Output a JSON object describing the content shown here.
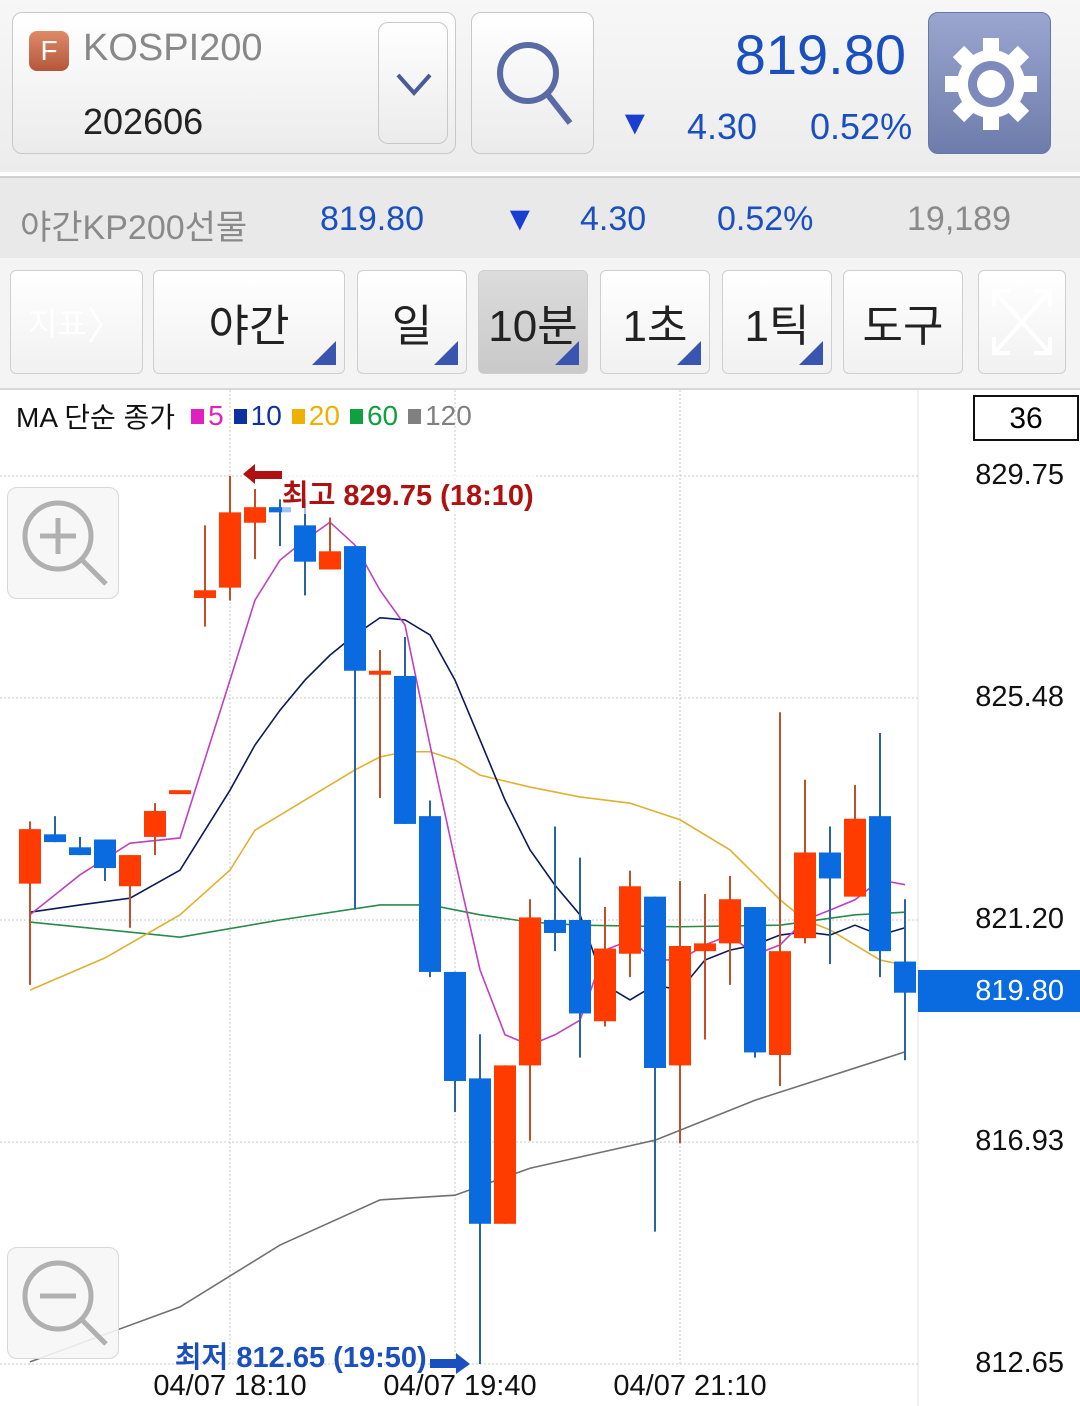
{
  "header": {
    "badge": "F",
    "symbol": "KOSPI200",
    "contract": "202606",
    "price": "819.80",
    "change_arrow": "▼",
    "change": "4.30",
    "change_pct": "0.52%"
  },
  "subbar": {
    "name": "야간KP200선물",
    "price": "819.80",
    "arrow": "▼",
    "change": "4.30",
    "change_pct": "0.52%",
    "volume": "19,189"
  },
  "toolbar": {
    "indicator": "지표",
    "buttons": [
      {
        "label": "야간",
        "selected": false
      },
      {
        "label": "일",
        "selected": false
      },
      {
        "label": "10분",
        "selected": true
      },
      {
        "label": "1초",
        "selected": false
      },
      {
        "label": "1틱",
        "selected": false
      }
    ],
    "tools": "도구"
  },
  "colors": {
    "up": "#ff3b00",
    "down": "#0a6adf",
    "accent": "#1a4fc0",
    "high": "#b01010"
  },
  "chart_data": {
    "type": "candlestick",
    "legend": {
      "title": "MA 단순 종가",
      "items": [
        {
          "label": "5",
          "color": "#e020c0"
        },
        {
          "label": "10",
          "color": "#1030a0"
        },
        {
          "label": "20",
          "color": "#f0b000"
        },
        {
          "label": "60",
          "color": "#10a040"
        },
        {
          "label": "120",
          "color": "#808080"
        }
      ]
    },
    "visible_count": "36",
    "ylim": [
      812.65,
      829.75
    ],
    "yticks": [
      "829.75",
      "825.48",
      "821.20",
      "816.93",
      "812.65"
    ],
    "xticks": [
      {
        "index": 8,
        "label": "04/07 18:10"
      },
      {
        "index": 17,
        "label": "04/07 19:40"
      },
      {
        "index": 26,
        "label": "04/07 21:10"
      }
    ],
    "current_price": "819.80",
    "high_label": "최고 829.75 (18:10)",
    "high_index": 9,
    "low_label": "최저 812.65 (19:50)",
    "low_index": 18,
    "candles": [
      [
        821.9,
        823.1,
        819.95,
        822.95
      ],
      [
        822.85,
        823.2,
        822.7,
        822.7
      ],
      [
        822.6,
        822.8,
        822.45,
        822.45
      ],
      [
        822.75,
        822.75,
        821.95,
        822.2
      ],
      [
        821.85,
        822.45,
        821.05,
        822.45
      ],
      [
        822.8,
        823.45,
        822.45,
        823.3
      ],
      [
        823.7,
        823.7,
        823.7,
        823.7
      ],
      [
        827.4,
        828.8,
        826.85,
        827.55
      ],
      [
        827.6,
        829.75,
        827.35,
        829.05
      ],
      [
        828.85,
        829.5,
        828.15,
        829.15
      ],
      [
        829.15,
        829.3,
        828.4,
        829.05
      ],
      [
        828.8,
        829.3,
        827.45,
        828.1
      ],
      [
        827.95,
        828.95,
        827.95,
        828.3
      ],
      [
        828.4,
        828.4,
        821.4,
        826.0
      ],
      [
        825.95,
        826.4,
        823.55,
        826.0
      ],
      [
        825.9,
        826.65,
        823.05,
        823.05
      ],
      [
        823.2,
        823.5,
        820.1,
        820.2
      ],
      [
        820.2,
        820.2,
        817.5,
        818.1
      ],
      [
        818.15,
        819.0,
        812.65,
        815.35
      ],
      [
        815.35,
        818.4,
        815.35,
        818.4
      ],
      [
        818.4,
        821.6,
        816.95,
        821.25
      ],
      [
        821.2,
        823.0,
        820.6,
        820.95
      ],
      [
        821.2,
        822.4,
        818.55,
        819.4
      ],
      [
        819.25,
        821.45,
        819.15,
        820.65
      ],
      [
        820.55,
        822.15,
        820.1,
        821.85
      ],
      [
        821.65,
        821.65,
        815.2,
        818.35
      ],
      [
        818.4,
        821.95,
        816.9,
        820.7
      ],
      [
        820.6,
        821.7,
        818.9,
        820.75
      ],
      [
        820.75,
        822.05,
        819.95,
        821.6
      ],
      [
        821.45,
        821.45,
        818.55,
        818.65
      ],
      [
        818.6,
        825.2,
        818.0,
        820.6
      ],
      [
        820.85,
        823.9,
        820.75,
        822.5
      ],
      [
        822.5,
        823.0,
        820.35,
        822.0
      ],
      [
        821.65,
        823.8,
        821.65,
        823.15
      ],
      [
        823.2,
        824.8,
        820.1,
        820.6
      ],
      [
        820.4,
        821.6,
        818.5,
        819.8
      ]
    ],
    "ma": {
      "5": [
        [
          0,
          821.3
        ],
        [
          2,
          822.07
        ],
        [
          4,
          822.68
        ],
        [
          6,
          822.78
        ],
        [
          8,
          825.82
        ],
        [
          9,
          827.36
        ],
        [
          10,
          828.13
        ],
        [
          11,
          828.52
        ],
        [
          12,
          828.86
        ],
        [
          13,
          828.42
        ],
        [
          14,
          827.55
        ],
        [
          15,
          826.88
        ],
        [
          16,
          824.57
        ],
        [
          17,
          822.36
        ],
        [
          18,
          820.24
        ],
        [
          19,
          818.99
        ],
        [
          20,
          818.79
        ],
        [
          21,
          818.99
        ],
        [
          22,
          819.27
        ],
        [
          23,
          820.62
        ],
        [
          24,
          820.81
        ],
        [
          25,
          820.43
        ],
        [
          26,
          820.43
        ],
        [
          27,
          820.72
        ],
        [
          28,
          820.91
        ],
        [
          29,
          820.53
        ],
        [
          30,
          820.72
        ],
        [
          31,
          821.2
        ],
        [
          32,
          821.39
        ],
        [
          33,
          821.59
        ],
        [
          34,
          821.97
        ],
        [
          35,
          821.88
        ]
      ],
      "10": [
        [
          0,
          821.35
        ],
        [
          2,
          821.49
        ],
        [
          4,
          821.62
        ],
        [
          6,
          822.16
        ],
        [
          8,
          823.7
        ],
        [
          9,
          824.57
        ],
        [
          10,
          825.24
        ],
        [
          11,
          825.82
        ],
        [
          12,
          826.3
        ],
        [
          13,
          826.69
        ],
        [
          14,
          827.02
        ],
        [
          15,
          826.98
        ],
        [
          16,
          826.69
        ],
        [
          17,
          825.82
        ],
        [
          18,
          824.67
        ],
        [
          19,
          823.51
        ],
        [
          20,
          822.55
        ],
        [
          21,
          821.87
        ],
        [
          22,
          821.3
        ],
        [
          23,
          819.95
        ],
        [
          24,
          819.66
        ],
        [
          25,
          819.95
        ],
        [
          26,
          819.85
        ],
        [
          27,
          820.43
        ],
        [
          28,
          820.62
        ],
        [
          29,
          820.72
        ],
        [
          30,
          820.91
        ],
        [
          31,
          820.97
        ],
        [
          32,
          820.91
        ],
        [
          33,
          821.1
        ],
        [
          34,
          820.91
        ],
        [
          35,
          821.05
        ]
      ],
      "20": [
        [
          0,
          819.85
        ],
        [
          3,
          820.47
        ],
        [
          6,
          821.3
        ],
        [
          8,
          822.16
        ],
        [
          9,
          822.93
        ],
        [
          11,
          823.51
        ],
        [
          13,
          824.09
        ],
        [
          14,
          824.34
        ],
        [
          15,
          824.44
        ],
        [
          16,
          824.44
        ],
        [
          17,
          824.28
        ],
        [
          18,
          823.99
        ],
        [
          20,
          823.76
        ],
        [
          22,
          823.57
        ],
        [
          24,
          823.45
        ],
        [
          26,
          823.13
        ],
        [
          28,
          822.55
        ],
        [
          29,
          822.07
        ],
        [
          30,
          821.59
        ],
        [
          31,
          821.2
        ],
        [
          32,
          821.01
        ],
        [
          33,
          820.72
        ],
        [
          34,
          820.43
        ],
        [
          35,
          820.33
        ]
      ],
      "60": [
        [
          0,
          821.16
        ],
        [
          6,
          820.87
        ],
        [
          10,
          821.2
        ],
        [
          14,
          821.49
        ],
        [
          16,
          821.49
        ],
        [
          18,
          821.3
        ],
        [
          20,
          821.16
        ],
        [
          22,
          821.1
        ],
        [
          26,
          821.07
        ],
        [
          30,
          821.1
        ],
        [
          33,
          821.3
        ],
        [
          35,
          821.35
        ]
      ],
      "120": [
        [
          0,
          812.69
        ],
        [
          6,
          813.75
        ],
        [
          10,
          814.94
        ],
        [
          14,
          815.81
        ],
        [
          17,
          815.9
        ],
        [
          20,
          816.42
        ],
        [
          25,
          816.96
        ],
        [
          29,
          817.73
        ],
        [
          35,
          818.66
        ]
      ]
    }
  }
}
